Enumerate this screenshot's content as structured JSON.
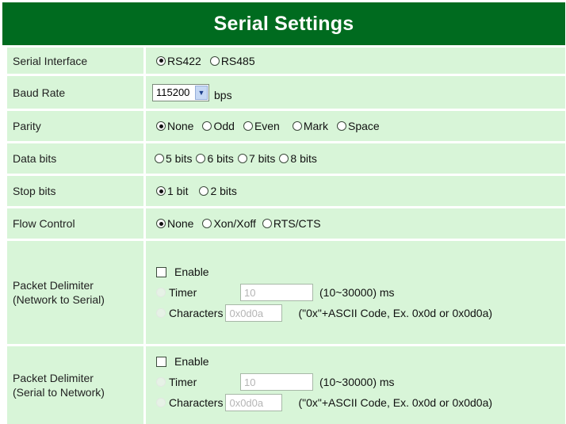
{
  "page": {
    "title": "Serial Settings",
    "colors": {
      "header_bg": "#006b1f",
      "row_bg": "#d8f5d8"
    }
  },
  "serial_interface": {
    "label": "Serial Interface",
    "options": [
      "RS422",
      "RS485"
    ],
    "selected": "RS422"
  },
  "baud_rate": {
    "label": "Baud Rate",
    "value": "115200",
    "unit": "bps"
  },
  "parity": {
    "label": "Parity",
    "options": [
      "None",
      "Odd",
      "Even",
      "Mark",
      "Space"
    ],
    "selected": "None"
  },
  "data_bits": {
    "label": "Data bits",
    "options": [
      "5 bits",
      "6 bits",
      "7 bits",
      "8 bits"
    ],
    "selected": ""
  },
  "stop_bits": {
    "label": "Stop bits",
    "options": [
      "1 bit",
      "2 bits"
    ],
    "selected": "1 bit"
  },
  "flow_control": {
    "label": "Flow Control",
    "options": [
      "None",
      "Xon/Xoff",
      "RTS/CTS"
    ],
    "selected": "None"
  },
  "delimiter_net_to_serial": {
    "label_line1": "Packet Delimiter",
    "label_line2": "(Network to Serial)",
    "enable_label": "Enable",
    "enabled": false,
    "timer_label": "Timer",
    "timer_value": "10",
    "timer_hint": "(10~30000) ms",
    "chars_label": "Characters",
    "chars_value": "0x0d0a",
    "chars_hint": "(\"0x\"+ASCII Code, Ex. 0x0d or 0x0d0a)"
  },
  "delimiter_serial_to_net": {
    "label_line1": "Packet Delimiter",
    "label_line2": "(Serial to Network)",
    "enable_label": "Enable",
    "enabled": false,
    "timer_label": "Timer",
    "timer_value": "10",
    "timer_hint": "(10~30000) ms",
    "chars_label": "Characters",
    "chars_value": "0x0d0a",
    "chars_hint": "(\"0x\"+ASCII Code, Ex. 0x0d or 0x0d0a)"
  }
}
